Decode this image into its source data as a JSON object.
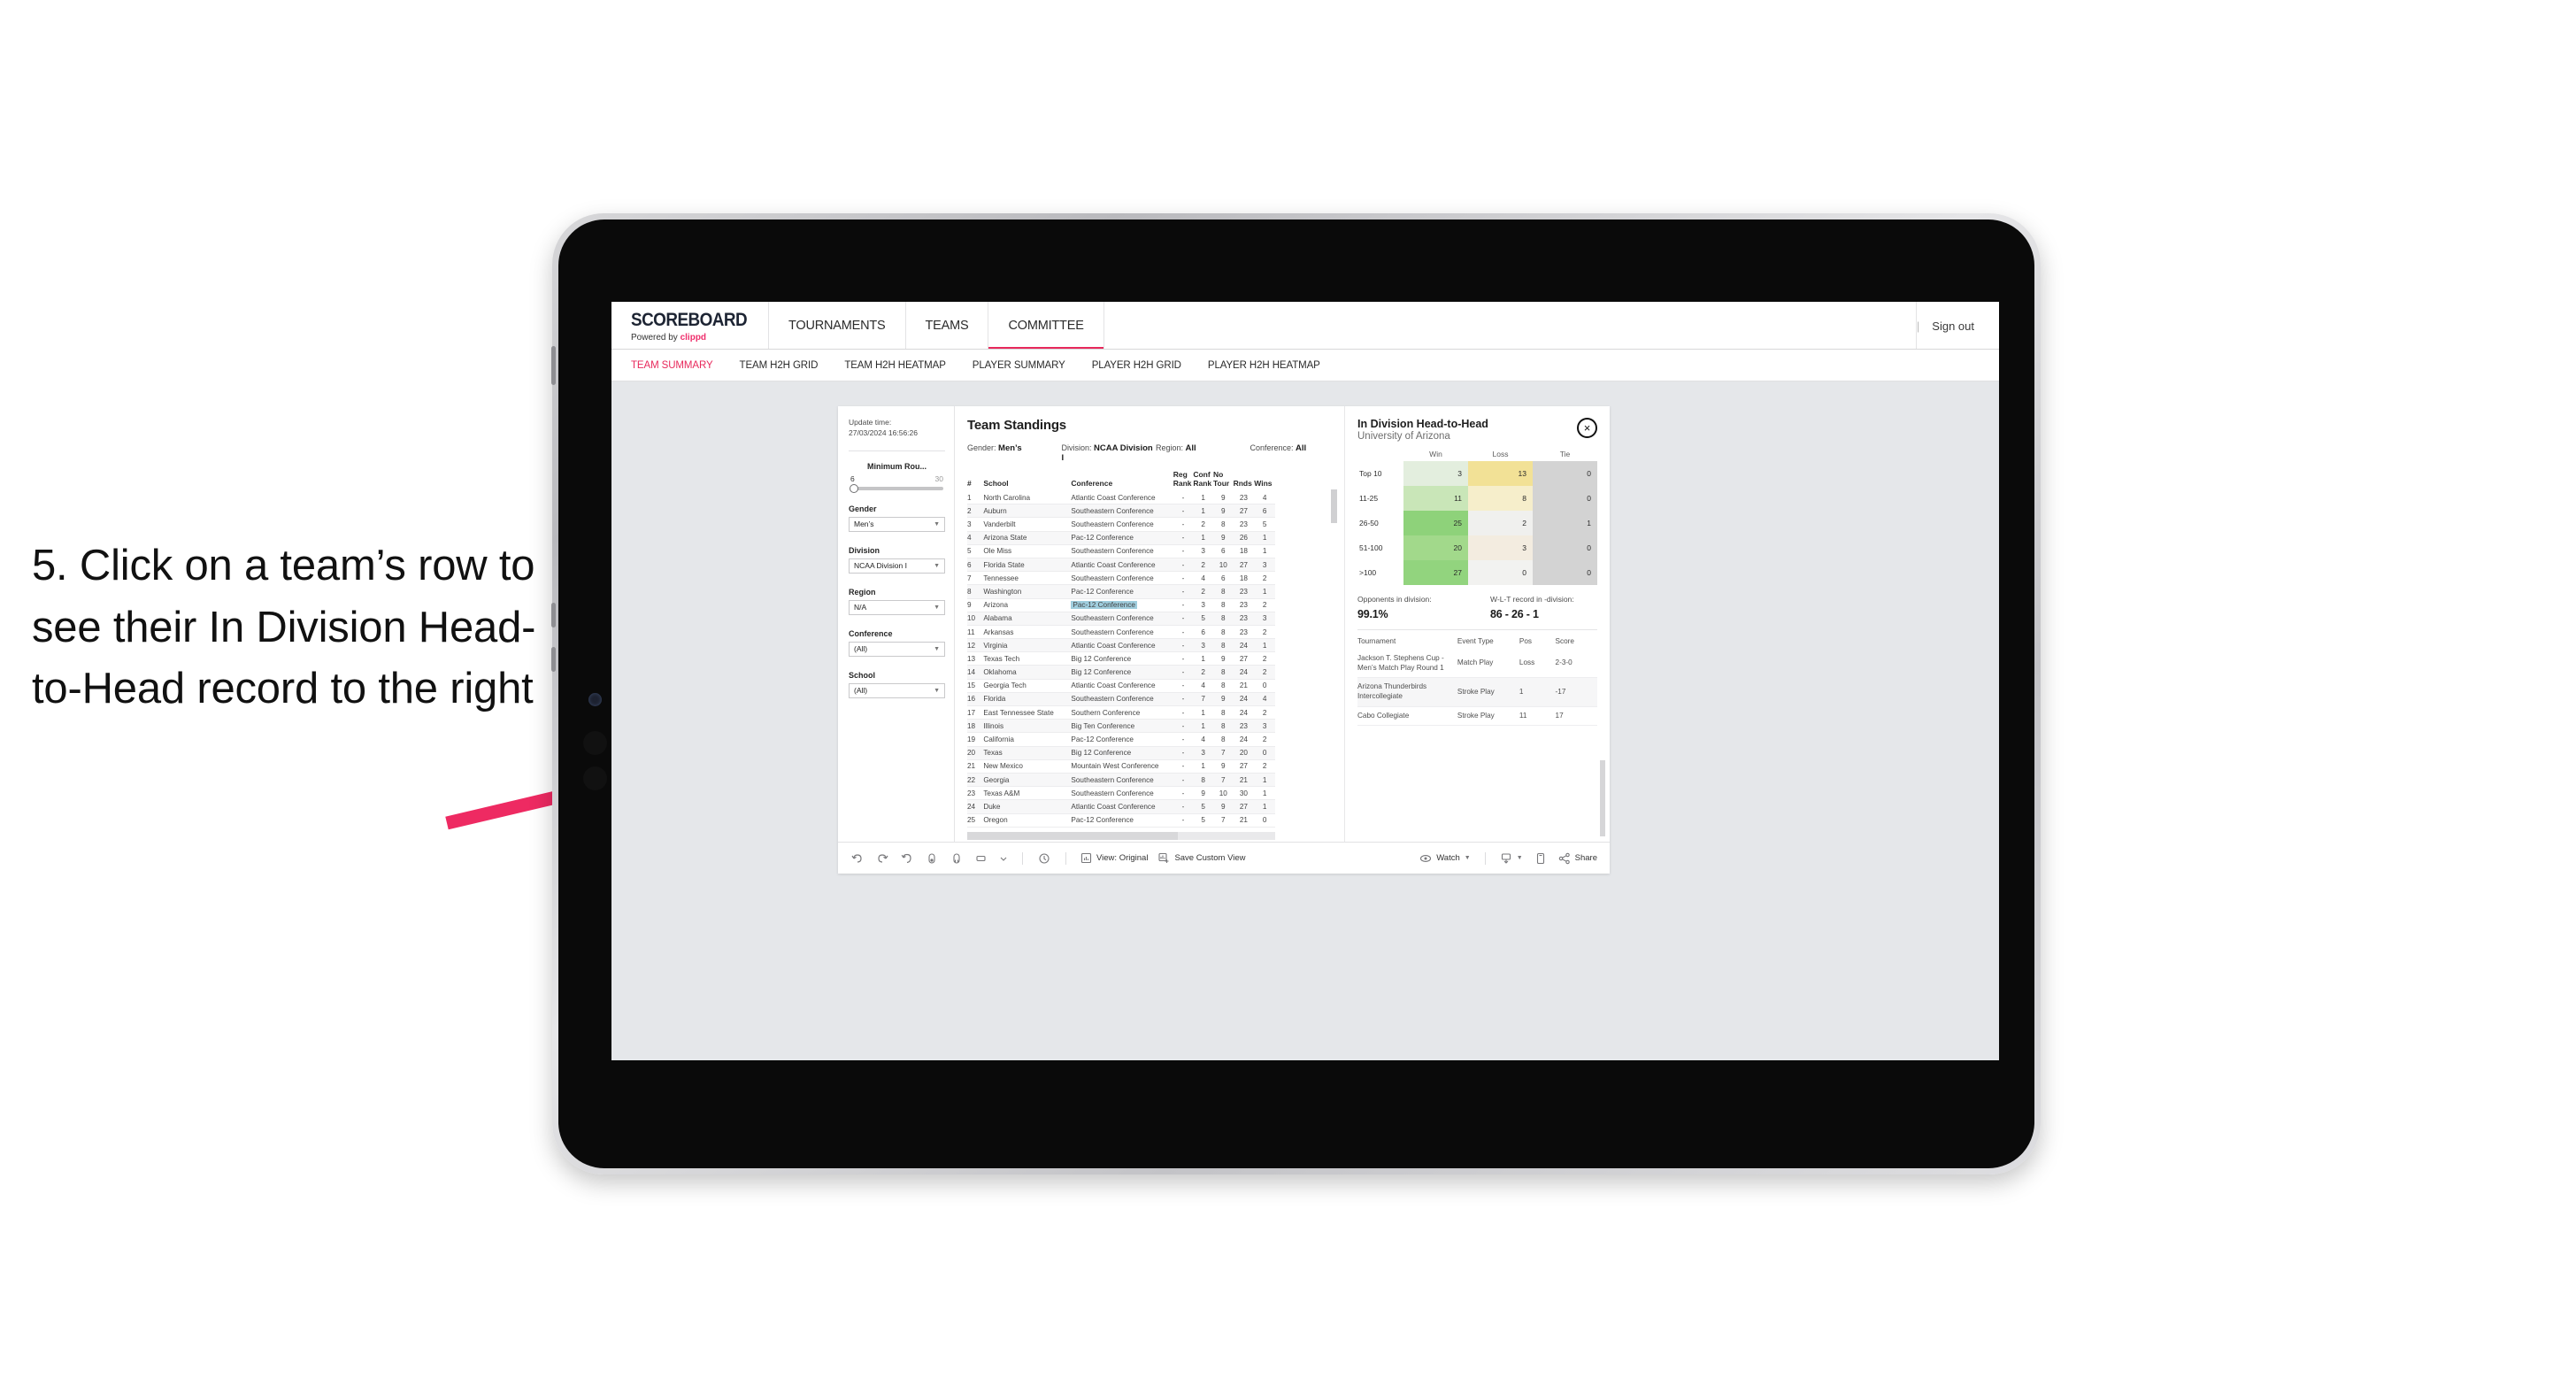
{
  "annotation": {
    "text": "5. Click on a team’s row to see their In Division Head-to-Head record to the right",
    "arrow_color": "#ee2a62"
  },
  "app": {
    "brand": {
      "title": "SCOREBOARD",
      "powered_prefix": "Powered by ",
      "powered_name": "clippd"
    },
    "topnav": [
      {
        "label": "TOURNAMENTS",
        "active": false
      },
      {
        "label": "TEAMS",
        "active": false
      },
      {
        "label": "COMMITTEE",
        "active": true
      }
    ],
    "signout": {
      "divider": "|",
      "label": "Sign out"
    },
    "subnav": [
      {
        "label": "TEAM SUMMARY",
        "active": true
      },
      {
        "label": "TEAM H2H GRID",
        "active": false
      },
      {
        "label": "TEAM H2H HEATMAP",
        "active": false
      },
      {
        "label": "PLAYER SUMMARY",
        "active": false
      },
      {
        "label": "PLAYER H2H GRID",
        "active": false
      },
      {
        "label": "PLAYER H2H HEATMAP",
        "active": false
      }
    ]
  },
  "filters": {
    "update_time_label": "Update time:",
    "update_time_value": "27/03/2024 16:56:26",
    "slider": {
      "label": "Minimum Rou...",
      "min": "6",
      "max": "30"
    },
    "groups": [
      {
        "label": "Gender",
        "value": "Men’s"
      },
      {
        "label": "Division",
        "value": "NCAA Division I"
      },
      {
        "label": "Region",
        "value": "N/A"
      },
      {
        "label": "Conference",
        "value": "(All)"
      },
      {
        "label": "School",
        "value": "(All)"
      }
    ]
  },
  "standings": {
    "title": "Team Standings",
    "summary": [
      {
        "key": "Gender:",
        "value": "Men’s"
      },
      {
        "key": "Division:",
        "value": "NCAA Division I"
      },
      {
        "key": "Region:",
        "value": "All"
      },
      {
        "key": "Conference:",
        "value": "All"
      }
    ],
    "columns": [
      "#",
      "School",
      "Conference",
      "Reg Rank",
      "Conf Rank",
      "No Tour",
      "Rnds",
      "Wins"
    ],
    "rows": [
      {
        "n": "1",
        "school": "North Carolina",
        "conf": "Atlantic Coast Conference",
        "reg": "-",
        "crank": "1",
        "notour": "9",
        "rnds": "23",
        "wins": "4"
      },
      {
        "n": "2",
        "school": "Auburn",
        "conf": "Southeastern Conference",
        "reg": "-",
        "crank": "1",
        "notour": "9",
        "rnds": "27",
        "wins": "6"
      },
      {
        "n": "3",
        "school": "Vanderbilt",
        "conf": "Southeastern Conference",
        "reg": "-",
        "crank": "2",
        "notour": "8",
        "rnds": "23",
        "wins": "5"
      },
      {
        "n": "4",
        "school": "Arizona State",
        "conf": "Pac-12 Conference",
        "reg": "-",
        "crank": "1",
        "notour": "9",
        "rnds": "26",
        "wins": "1"
      },
      {
        "n": "5",
        "school": "Ole Miss",
        "conf": "Southeastern Conference",
        "reg": "-",
        "crank": "3",
        "notour": "6",
        "rnds": "18",
        "wins": "1"
      },
      {
        "n": "6",
        "school": "Florida State",
        "conf": "Atlantic Coast Conference",
        "reg": "-",
        "crank": "2",
        "notour": "10",
        "rnds": "27",
        "wins": "3"
      },
      {
        "n": "7",
        "school": "Tennessee",
        "conf": "Southeastern Conference",
        "reg": "-",
        "crank": "4",
        "notour": "6",
        "rnds": "18",
        "wins": "2"
      },
      {
        "n": "8",
        "school": "Washington",
        "conf": "Pac-12 Conference",
        "reg": "-",
        "crank": "2",
        "notour": "8",
        "rnds": "23",
        "wins": "1"
      },
      {
        "n": "9",
        "school": "Arizona",
        "conf": "Pac-12 Conference",
        "reg": "-",
        "crank": "3",
        "notour": "8",
        "rnds": "23",
        "wins": "2",
        "selected": true
      },
      {
        "n": "10",
        "school": "Alabama",
        "conf": "Southeastern Conference",
        "reg": "-",
        "crank": "5",
        "notour": "8",
        "rnds": "23",
        "wins": "3"
      },
      {
        "n": "11",
        "school": "Arkansas",
        "conf": "Southeastern Conference",
        "reg": "-",
        "crank": "6",
        "notour": "8",
        "rnds": "23",
        "wins": "2"
      },
      {
        "n": "12",
        "school": "Virginia",
        "conf": "Atlantic Coast Conference",
        "reg": "-",
        "crank": "3",
        "notour": "8",
        "rnds": "24",
        "wins": "1"
      },
      {
        "n": "13",
        "school": "Texas Tech",
        "conf": "Big 12 Conference",
        "reg": "-",
        "crank": "1",
        "notour": "9",
        "rnds": "27",
        "wins": "2"
      },
      {
        "n": "14",
        "school": "Oklahoma",
        "conf": "Big 12 Conference",
        "reg": "-",
        "crank": "2",
        "notour": "8",
        "rnds": "24",
        "wins": "2"
      },
      {
        "n": "15",
        "school": "Georgia Tech",
        "conf": "Atlantic Coast Conference",
        "reg": "-",
        "crank": "4",
        "notour": "8",
        "rnds": "21",
        "wins": "0"
      },
      {
        "n": "16",
        "school": "Florida",
        "conf": "Southeastern Conference",
        "reg": "-",
        "crank": "7",
        "notour": "9",
        "rnds": "24",
        "wins": "4"
      },
      {
        "n": "17",
        "school": "East Tennessee State",
        "conf": "Southern Conference",
        "reg": "-",
        "crank": "1",
        "notour": "8",
        "rnds": "24",
        "wins": "2"
      },
      {
        "n": "18",
        "school": "Illinois",
        "conf": "Big Ten Conference",
        "reg": "-",
        "crank": "1",
        "notour": "8",
        "rnds": "23",
        "wins": "3"
      },
      {
        "n": "19",
        "school": "California",
        "conf": "Pac-12 Conference",
        "reg": "-",
        "crank": "4",
        "notour": "8",
        "rnds": "24",
        "wins": "2"
      },
      {
        "n": "20",
        "school": "Texas",
        "conf": "Big 12 Conference",
        "reg": "-",
        "crank": "3",
        "notour": "7",
        "rnds": "20",
        "wins": "0"
      },
      {
        "n": "21",
        "school": "New Mexico",
        "conf": "Mountain West Conference",
        "reg": "-",
        "crank": "1",
        "notour": "9",
        "rnds": "27",
        "wins": "2"
      },
      {
        "n": "22",
        "school": "Georgia",
        "conf": "Southeastern Conference",
        "reg": "-",
        "crank": "8",
        "notour": "7",
        "rnds": "21",
        "wins": "1"
      },
      {
        "n": "23",
        "school": "Texas A&M",
        "conf": "Southeastern Conference",
        "reg": "-",
        "crank": "9",
        "notour": "10",
        "rnds": "30",
        "wins": "1"
      },
      {
        "n": "24",
        "school": "Duke",
        "conf": "Atlantic Coast Conference",
        "reg": "-",
        "crank": "5",
        "notour": "9",
        "rnds": "27",
        "wins": "1"
      },
      {
        "n": "25",
        "school": "Oregon",
        "conf": "Pac-12 Conference",
        "reg": "-",
        "crank": "5",
        "notour": "7",
        "rnds": "21",
        "wins": "0"
      }
    ]
  },
  "h2h": {
    "title": "In Division Head-to-Head",
    "subtitle": "University of Arizona",
    "close_icon": "×",
    "columns": [
      "",
      "Win",
      "Loss",
      "Tie"
    ],
    "rows": [
      {
        "band": "Top 10",
        "win": "3",
        "loss": "13",
        "tie": "0",
        "win_bg": "#e3eede",
        "loss_bg": "#f2e196",
        "tie_bg": "#d3d3d3"
      },
      {
        "band": "11-25",
        "win": "11",
        "loss": "8",
        "tie": "0",
        "win_bg": "#c9e6b8",
        "loss_bg": "#f6eecb",
        "tie_bg": "#d3d3d3"
      },
      {
        "band": "26-50",
        "win": "25",
        "loss": "2",
        "tie": "1",
        "win_bg": "#8ed27a",
        "loss_bg": "#f0f0ee",
        "tie_bg": "#d3d3d3"
      },
      {
        "band": "51-100",
        "win": "20",
        "loss": "3",
        "tie": "0",
        "win_bg": "#a2d98b",
        "loss_bg": "#f3ece0",
        "tie_bg": "#d3d3d3"
      },
      {
        "band": ">100",
        "win": "27",
        "loss": "0",
        "tie": "0",
        "win_bg": "#92d47e",
        "loss_bg": "#f2f2f0",
        "tie_bg": "#d3d3d3"
      }
    ],
    "stats": [
      {
        "label": "Opponents in division:",
        "value": "99.1%"
      },
      {
        "label": "W-L-T record in -division:",
        "value": "86 - 26 - 1"
      }
    ],
    "tournament_columns": [
      "Tournament",
      "Event Type",
      "Pos",
      "Score"
    ],
    "tournaments": [
      {
        "name": "Jackson T. Stephens Cup - Men’s Match Play Round 1",
        "type": "Match Play",
        "pos": "Loss",
        "score": "2-3-0"
      },
      {
        "name": "Arizona Thunderbirds Intercollegiate",
        "type": "Stroke Play",
        "pos": "1",
        "score": "-17"
      },
      {
        "name": "Cabo Collegiate",
        "type": "Stroke Play",
        "pos": "11",
        "score": "17"
      }
    ]
  },
  "toolbar": {
    "view_label": "View: Original",
    "save_label": "Save Custom View",
    "watch_label": "Watch",
    "share_label": "Share"
  }
}
